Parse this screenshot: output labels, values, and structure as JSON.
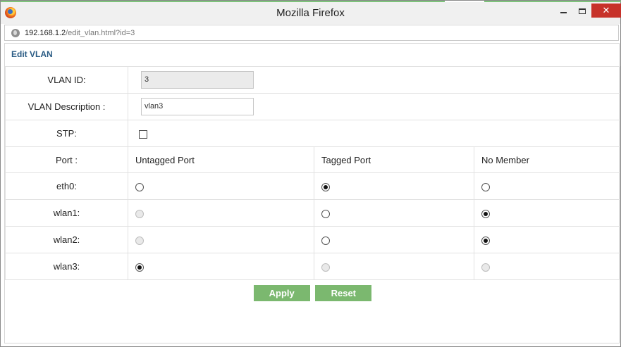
{
  "window": {
    "title": "Mozilla Firefox",
    "close_glyph": "✕"
  },
  "address": {
    "host": "192.168.1.2",
    "path": "/edit_vlan.html?id=3"
  },
  "page": {
    "title": "Edit VLAN"
  },
  "form": {
    "vlan_id_label": "VLAN ID:",
    "vlan_id_value": "3",
    "vlan_desc_label": "VLAN Description :",
    "vlan_desc_value": "vlan3",
    "stp_label": "STP:",
    "stp_checked": false
  },
  "ports_table": {
    "headers": [
      "Port :",
      "Untagged Port",
      "Tagged Port",
      "No Member"
    ],
    "rows": [
      {
        "port": "eth0:",
        "untagged": {
          "checked": false,
          "disabled": false
        },
        "tagged": {
          "checked": true,
          "disabled": false
        },
        "none": {
          "checked": false,
          "disabled": false
        }
      },
      {
        "port": "wlan1:",
        "untagged": {
          "checked": false,
          "disabled": true
        },
        "tagged": {
          "checked": false,
          "disabled": false
        },
        "none": {
          "checked": true,
          "disabled": false
        }
      },
      {
        "port": "wlan2:",
        "untagged": {
          "checked": false,
          "disabled": true
        },
        "tagged": {
          "checked": false,
          "disabled": false
        },
        "none": {
          "checked": true,
          "disabled": false
        }
      },
      {
        "port": "wlan3:",
        "untagged": {
          "checked": true,
          "disabled": false
        },
        "tagged": {
          "checked": false,
          "disabled": true
        },
        "none": {
          "checked": false,
          "disabled": true
        }
      }
    ]
  },
  "buttons": {
    "apply": "Apply",
    "reset": "Reset"
  },
  "colors": {
    "button_green": "#7bb86f",
    "title_blue": "#2a5b84",
    "close_red": "#c7322a"
  }
}
